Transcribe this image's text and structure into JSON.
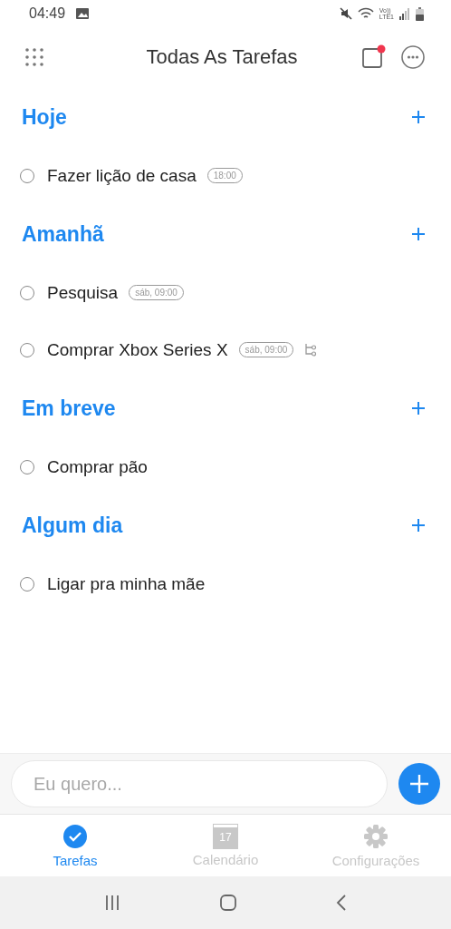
{
  "status_bar": {
    "time": "04:49",
    "volte": "Vo))",
    "network": "LTE1"
  },
  "header": {
    "title": "Todas As Tarefas",
    "notification": true
  },
  "sections": [
    {
      "title": "Hoje",
      "tasks": [
        {
          "title": "Fazer lição de casa",
          "checked": false,
          "time": "18:00"
        }
      ]
    },
    {
      "title": "Amanhã",
      "tasks": [
        {
          "title": "Pesquisa",
          "checked": false,
          "time": "sáb, 09:00"
        },
        {
          "title": "Comprar Xbox Series X",
          "checked": false,
          "time": "sáb, 09:00",
          "has_subtasks": true
        }
      ]
    },
    {
      "title": "Em breve",
      "tasks": [
        {
          "title": "Comprar pão",
          "checked": false
        }
      ]
    },
    {
      "title": "Algum dia",
      "tasks": [
        {
          "title": "Ligar pra minha mãe",
          "checked": false
        }
      ]
    }
  ],
  "composer": {
    "placeholder": "Eu quero..."
  },
  "tabs": [
    {
      "label": "Tarefas",
      "kind": "tasks",
      "selected": true
    },
    {
      "label": "Calendário",
      "kind": "calendar",
      "day": "17",
      "selected": false
    },
    {
      "label": "Configurações",
      "kind": "settings",
      "selected": false
    }
  ]
}
